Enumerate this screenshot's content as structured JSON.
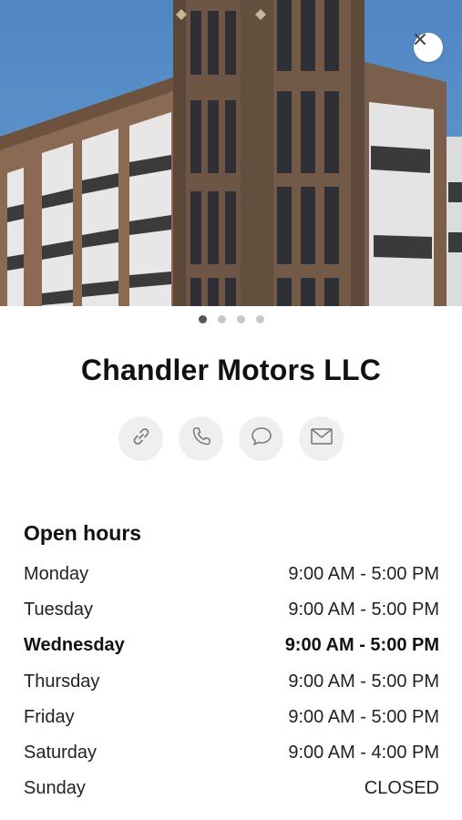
{
  "business": {
    "name": "Chandler Motors LLC"
  },
  "gallery": {
    "page_count": 4,
    "active_index": 0
  },
  "icons": {
    "close": "close-icon",
    "website": "link-icon",
    "phone": "phone-icon",
    "message": "message-icon",
    "email": "mail-icon"
  },
  "hours": {
    "title": "Open hours",
    "days": [
      {
        "day": "Monday",
        "time": "9:00 AM - 5:00 PM",
        "today": false
      },
      {
        "day": "Tuesday",
        "time": "9:00 AM - 5:00 PM",
        "today": false
      },
      {
        "day": "Wednesday",
        "time": "9:00 AM - 5:00 PM",
        "today": true
      },
      {
        "day": "Thursday",
        "time": "9:00 AM - 5:00 PM",
        "today": false
      },
      {
        "day": "Friday",
        "time": "9:00 AM - 5:00 PM",
        "today": false
      },
      {
        "day": "Saturday",
        "time": "9:00 AM - 4:00 PM",
        "today": false
      },
      {
        "day": "Sunday",
        "time": "CLOSED",
        "today": false
      }
    ]
  },
  "colors": {
    "dot_active": "#555555",
    "dot_inactive": "#c8c8c8",
    "button_bg": "#efefef"
  }
}
